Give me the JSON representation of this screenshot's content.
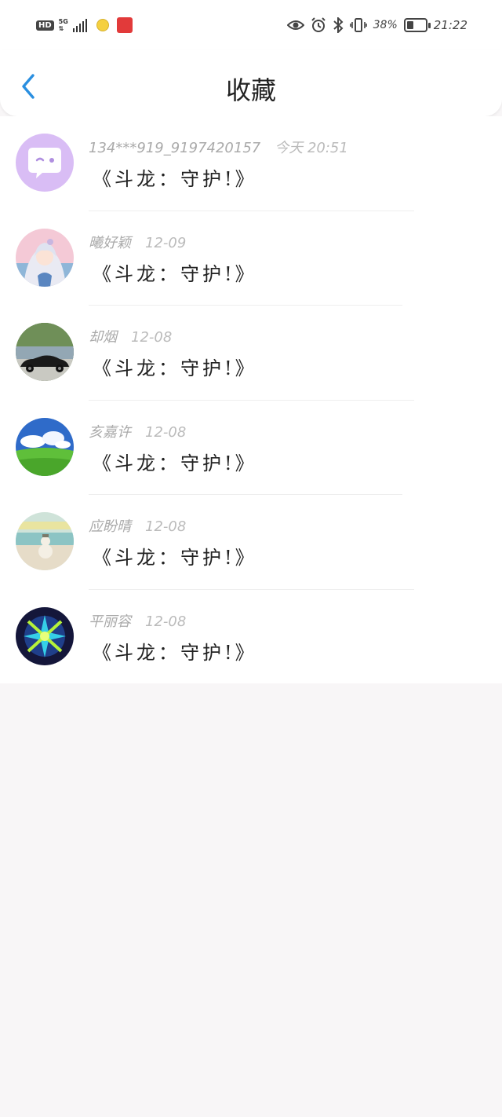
{
  "status_bar": {
    "hd": "HD",
    "net": "5G",
    "battery_pct": "38%",
    "battery_level": 0.38,
    "time": "21:22"
  },
  "header": {
    "title": "收藏",
    "back_icon": "chevron-left-icon",
    "accent": "#2a8fe0"
  },
  "favorites": [
    {
      "user": "134***919_9197420157",
      "date": "今天 20:51",
      "book": "《斗龙：守护!》",
      "avatar": "chat-bubble"
    },
    {
      "user": "曦好颖",
      "date": "12-09",
      "book": "《斗龙：守护!》",
      "avatar": "anime-girl"
    },
    {
      "user": "却烟",
      "date": "12-08",
      "book": "《斗龙：守护!》",
      "avatar": "black-car"
    },
    {
      "user": "亥嘉许",
      "date": "12-08",
      "book": "《斗龙：守护!》",
      "avatar": "sky-grass"
    },
    {
      "user": "应盼晴",
      "date": "12-08",
      "book": "《斗龙：守护!》",
      "avatar": "beach-snowman"
    },
    {
      "user": "平丽容",
      "date": "12-08",
      "book": "《斗龙：守护!》",
      "avatar": "neon-burst"
    }
  ]
}
